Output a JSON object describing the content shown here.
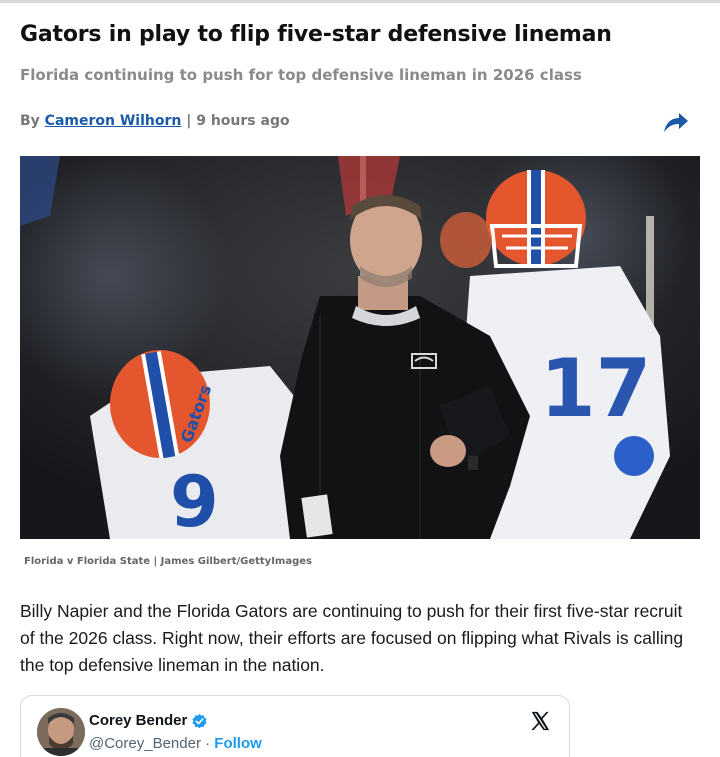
{
  "article": {
    "headline": "Gators in play to flip five-star defensive lineman",
    "subheadline": "Florida continuing to push for top defensive lineman in 2026 class",
    "byline_prefix": "By",
    "author": "Cameron Wilhorn",
    "separator": "|",
    "timestamp": "9 hours ago",
    "share_icon": "share-arrow-icon",
    "photo_caption": "Florida v Florida State | James Gilbert/GettyImages",
    "body_text": "Billy Napier and the Florida Gators are continuing to push for their first five-star recruit of the 2026 class. Right now, their efforts are focused on flipping what Rivals is calling the top defensive lineman in the nation."
  },
  "embed": {
    "name": "Corey Bender",
    "handle": "@Corey_Bender",
    "dot": "·",
    "follow_label": "Follow",
    "platform_icon": "x-logo-icon",
    "verified_icon": "verified-badge-icon"
  },
  "colors": {
    "link": "#1a5aa8",
    "subhead": "#8a8a8a",
    "share": "#1a5aa8",
    "follow": "#1d9bf0",
    "verified": "#1d9bf0",
    "gator_orange": "#e8612c",
    "gator_blue": "#1f4fa8"
  }
}
